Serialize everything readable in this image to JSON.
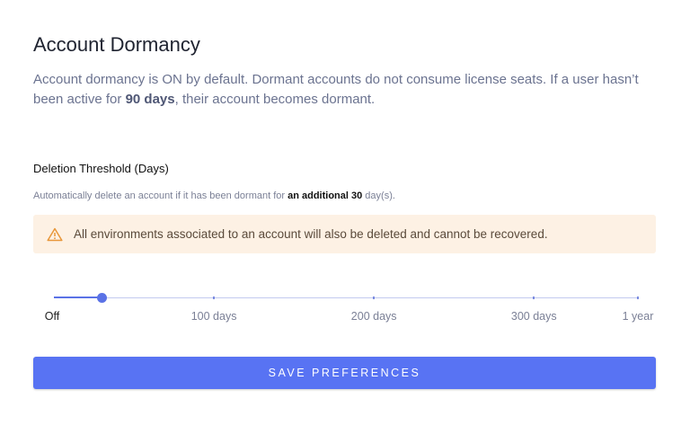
{
  "title": "Account Dormancy",
  "description": {
    "part1": "Account dormancy is ON by default. Dormant accounts do not consume license seats. If a user hasn’t been active for ",
    "bold": "90 days",
    "part2": ", their account becomes dormant."
  },
  "threshold": {
    "label": "Deletion Threshold (Days)",
    "help_part1": "Automatically delete an account if it has been dormant for ",
    "help_bold": "an additional 30",
    "help_part2": " day(s)."
  },
  "warning": {
    "icon": "warning-triangle-icon",
    "text": "All environments associated to an account will also be deleted and cannot be recovered.",
    "color": "#e8973a"
  },
  "slider": {
    "value": 30,
    "min": 0,
    "max": 365,
    "ticks": [
      {
        "value": 0,
        "label": "Off"
      },
      {
        "value": 100,
        "label": "100 days"
      },
      {
        "value": 200,
        "label": "200 days"
      },
      {
        "value": 300,
        "label": "300 days"
      },
      {
        "value": 365,
        "label": "1 year"
      }
    ]
  },
  "save_label": "SAVE PREFERENCES",
  "accent": "#5873f3"
}
